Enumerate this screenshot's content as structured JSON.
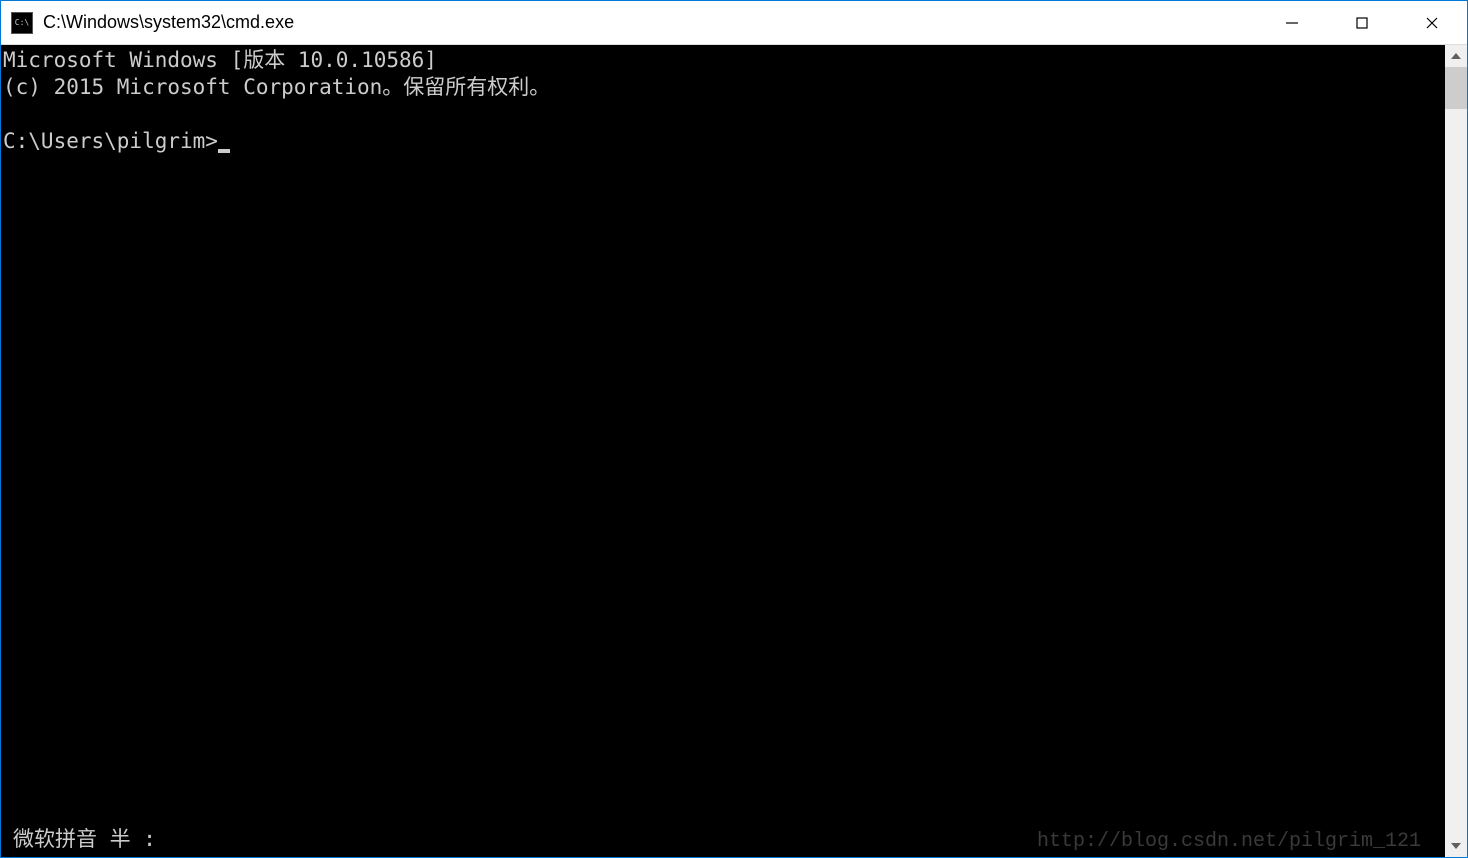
{
  "window": {
    "title": "C:\\Windows\\system32\\cmd.exe",
    "icon_label": "C:\\"
  },
  "terminal": {
    "line1": "Microsoft Windows [版本 10.0.10586]",
    "line2": "(c) 2015 Microsoft Corporation。保留所有权利。",
    "blank": "",
    "prompt": "C:\\Users\\pilgrim>"
  },
  "ime": "微软拼音 半 :",
  "watermark": "http://blog.csdn.net/pilgrim_121"
}
